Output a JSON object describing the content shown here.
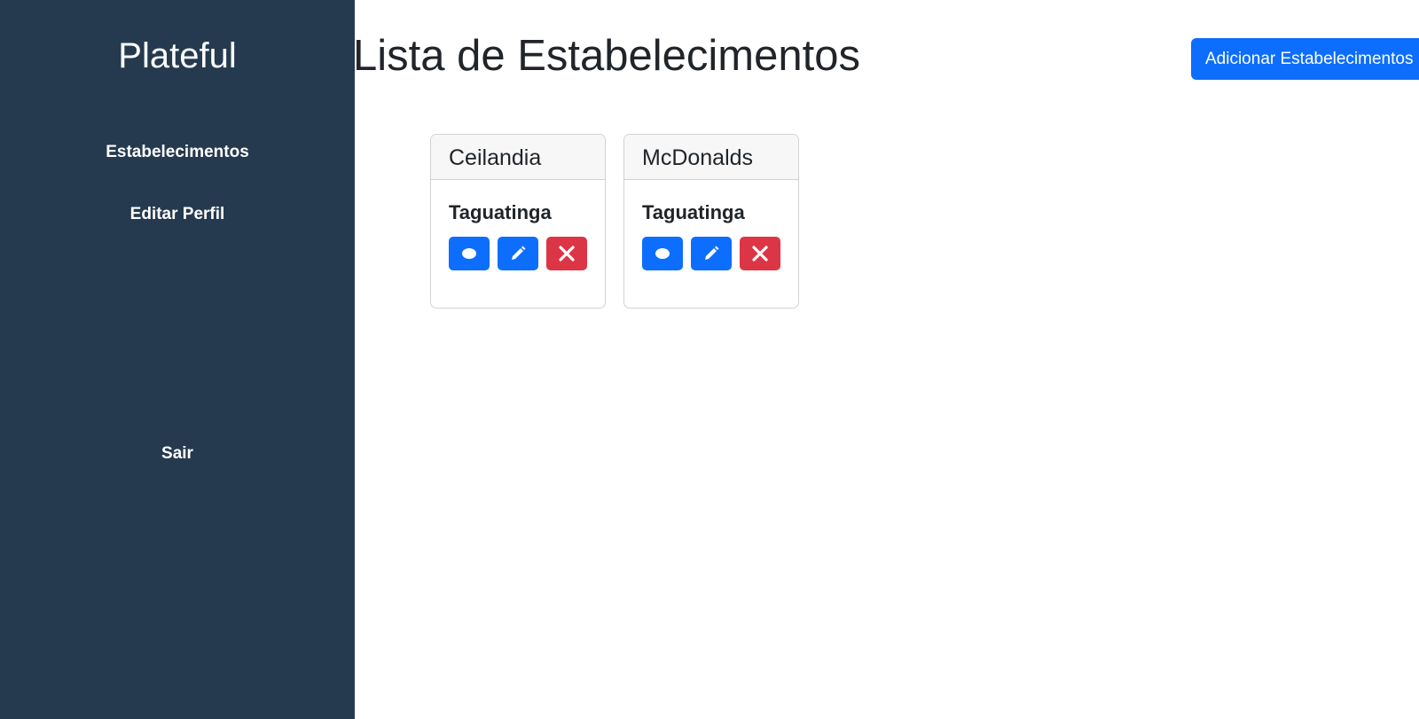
{
  "sidebar": {
    "brand": "Plateful",
    "items": [
      {
        "label": "Estabelecimentos"
      },
      {
        "label": "Editar Perfil"
      }
    ],
    "logout_label": "Sair"
  },
  "header": {
    "title": "Lista de Estabelecimentos",
    "add_button_label": "Adicionar Estabelecimentos"
  },
  "establishments": [
    {
      "name": "Ceilandia",
      "location": "Taguatinga",
      "actions": [
        "eye-icon",
        "pencil-icon",
        "close-icon"
      ]
    },
    {
      "name": "McDonalds",
      "location": "Taguatinga",
      "actions": [
        "eye-icon",
        "pencil-icon",
        "close-icon"
      ]
    }
  ],
  "colors": {
    "sidebar_bg": "#253a4f",
    "primary": "#0d6efd",
    "danger": "#dc3545"
  }
}
